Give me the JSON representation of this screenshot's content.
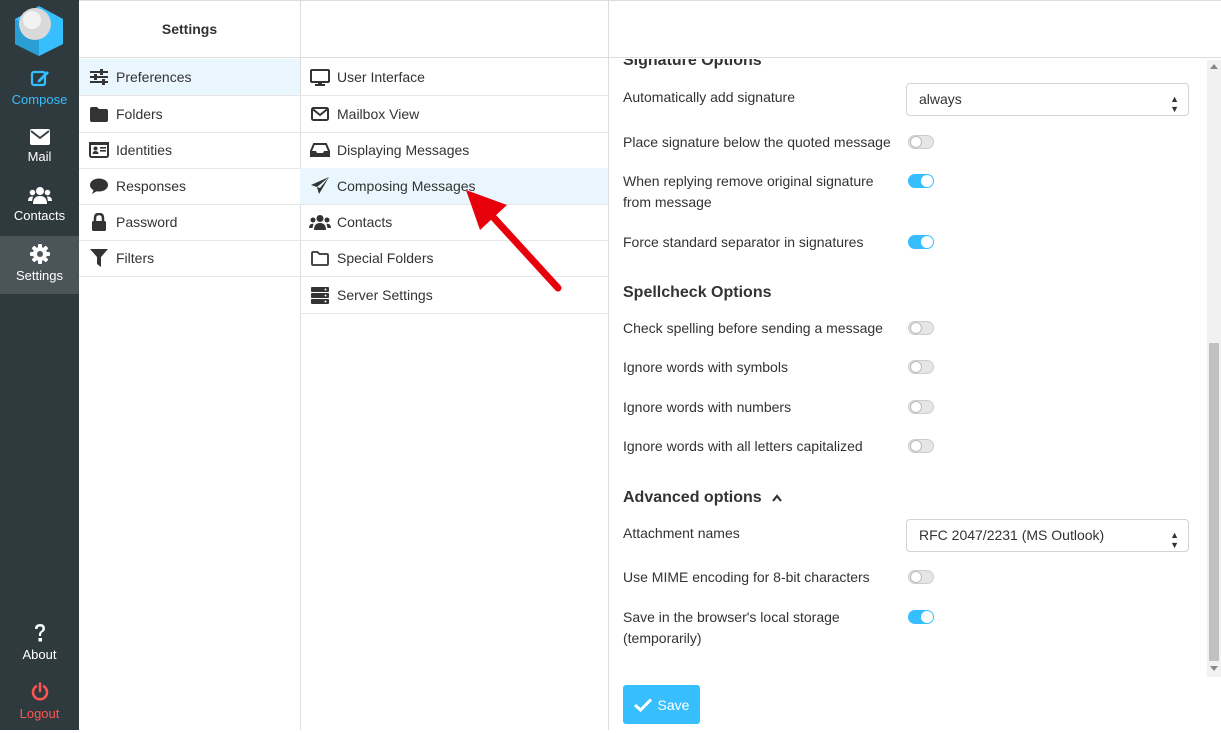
{
  "taskmenu": {
    "compose": "Compose",
    "mail": "Mail",
    "contacts": "Contacts",
    "settings": "Settings",
    "about": "About",
    "logout": "Logout"
  },
  "settings_header": "Settings",
  "settings_nav": [
    {
      "label": "Preferences",
      "icon": "sliders-icon"
    },
    {
      "label": "Folders",
      "icon": "folder-icon"
    },
    {
      "label": "Identities",
      "icon": "id-card-icon"
    },
    {
      "label": "Responses",
      "icon": "comment-icon"
    },
    {
      "label": "Password",
      "icon": "lock-icon"
    },
    {
      "label": "Filters",
      "icon": "filter-icon"
    }
  ],
  "sections_nav": [
    {
      "label": "User Interface",
      "icon": "monitor-icon"
    },
    {
      "label": "Mailbox View",
      "icon": "envelope-icon"
    },
    {
      "label": "Displaying Messages",
      "icon": "inbox-icon"
    },
    {
      "label": "Composing Messages",
      "icon": "paper-plane-icon"
    },
    {
      "label": "Contacts",
      "icon": "users-icon"
    },
    {
      "label": "Special Folders",
      "icon": "folder-outline-icon"
    },
    {
      "label": "Server Settings",
      "icon": "server-icon"
    }
  ],
  "content": {
    "signature_title": "Signature Options",
    "auto_add_signature": {
      "label": "Automatically add signature",
      "value": "always"
    },
    "place_below": {
      "label": "Place signature below the quoted message",
      "on": false
    },
    "remove_original_1": "When replying remove original signature",
    "remove_original_2": "from message",
    "remove_original_on": true,
    "force_separator": {
      "label": "Force standard separator in signatures",
      "on": true
    },
    "spellcheck_title": "Spellcheck Options",
    "check_spelling": {
      "label": "Check spelling before sending a message",
      "on": false
    },
    "ignore_symbols": {
      "label": "Ignore words with symbols",
      "on": false
    },
    "ignore_numbers": {
      "label": "Ignore words with numbers",
      "on": false
    },
    "ignore_caps": {
      "label": "Ignore words with all letters capitalized",
      "on": false
    },
    "advanced_title": "Advanced options",
    "attachment_names": {
      "label": "Attachment names",
      "value": "RFC 2047/2231 (MS Outlook)"
    },
    "mime_encoding": {
      "label": "Use MIME encoding for 8-bit characters",
      "on": false
    },
    "local_storage_1": "Save in the browser's local storage",
    "local_storage_2": "(temporarily)",
    "local_storage_on": true,
    "save_label": "Save"
  },
  "colors": {
    "accent": "#37beff",
    "sidebar": "#2f3a3f",
    "arrow": "#e8000b",
    "logout": "#ff5552"
  }
}
